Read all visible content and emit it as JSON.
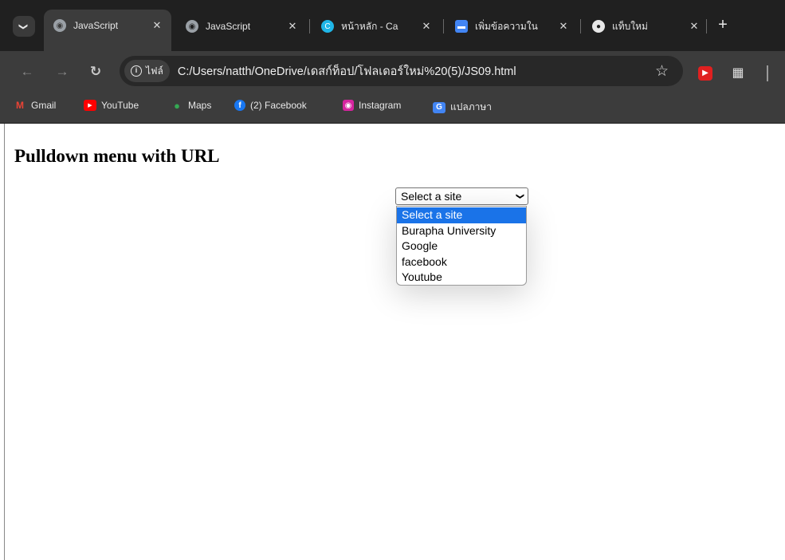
{
  "tabs": [
    {
      "title": "JavaScript",
      "icon": "globe-icon",
      "active": true
    },
    {
      "title": "JavaScript",
      "icon": "globe-icon",
      "active": false
    },
    {
      "title": "หน้าหลัก - Ca",
      "icon": "canva-icon",
      "active": false
    },
    {
      "title": "เพิ่มข้อความใน",
      "icon": "docs-icon",
      "active": false
    },
    {
      "title": "แท็บใหม่",
      "icon": "chrome-icon",
      "active": false
    }
  ],
  "address_bar": {
    "chip_label": "ไฟล์",
    "url": "C:/Users/natth/OneDrive/เดสก์ท็อป/โฟลเดอร์ใหม่%20(5)/JS09.html"
  },
  "bookmarks": [
    {
      "label": "Gmail",
      "icon": "gmail-icon"
    },
    {
      "label": "YouTube",
      "icon": "youtube-icon"
    },
    {
      "label": "Maps",
      "icon": "maps-icon"
    },
    {
      "label": "(2) Facebook",
      "icon": "facebook-icon"
    },
    {
      "label": "Instagram",
      "icon": "instagram-icon"
    },
    {
      "label": "แปลภาษา",
      "icon": "translate-icon"
    }
  ],
  "page": {
    "heading": "Pulldown menu with URL",
    "select": {
      "selected": "Select a site",
      "options": [
        "Select a site",
        "Burapha University",
        "Google",
        "facebook",
        "Youtube"
      ],
      "highlighted_index": 0
    }
  },
  "colors": {
    "tabstrip": "#202020",
    "toolbar": "#3c3c3c",
    "highlight": "#1a73e8"
  }
}
